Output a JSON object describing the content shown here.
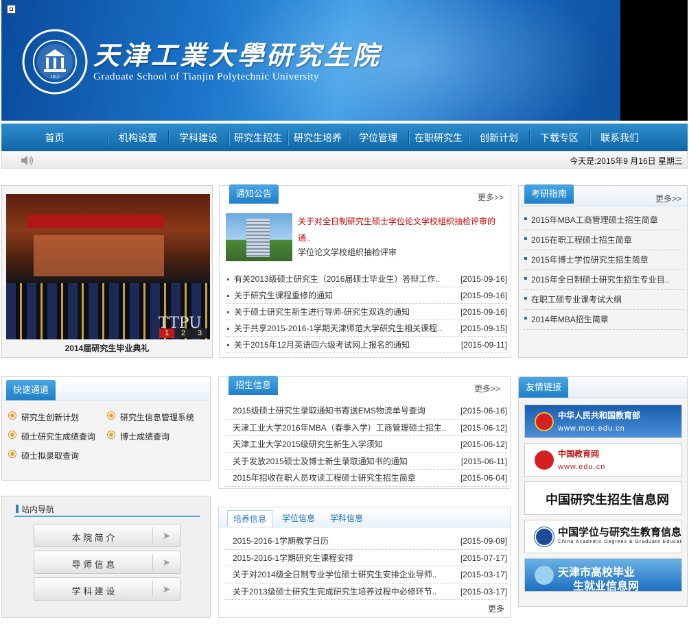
{
  "header": {
    "title_cn": "天津工業大學研究生院",
    "title_en": "Graduate School of Tianjin Polytechnic University"
  },
  "nav": [
    "首页",
    "机构设置",
    "学科建设",
    "研究生招生",
    "研究生培养",
    "学位管理",
    "在职研究生",
    "创新计划",
    "下载专区",
    "联系我们"
  ],
  "date_text": "今天是:2015年9 月16日  星期三",
  "slideshow": {
    "caption": "2014届研究生毕业典礼",
    "overlay": "TTPU",
    "pages": [
      "1",
      "2",
      "3"
    ],
    "active": "1"
  },
  "notice": {
    "title": "通知公告",
    "more": "更多>>",
    "headline": "关于对全日制研究生硕士学位论文学校组织抽检评审的通..",
    "summary": "学位论文学校组织抽检评审",
    "items": [
      {
        "t": "有关2013级硕士研究生（2016届硕士毕业生）答辩工作..",
        "d": "[2015-09-16]"
      },
      {
        "t": "关于研究生课程重修的通知",
        "d": "[2015-09-16]"
      },
      {
        "t": "关于硕士研究生新生进行导师-研究生双选的通知",
        "d": "[2015-09-16]"
      },
      {
        "t": "关于共享2015-2016-1学期天津师范大学研究生相关课程..",
        "d": "[2015-09-15]"
      },
      {
        "t": "关于2015年12月英语四六级考试网上报名的通知",
        "d": "[2015-09-11]"
      }
    ]
  },
  "guide": {
    "title": "考研指南",
    "more": "更多>>",
    "items": [
      "2015年MBA工商管理硕士招生简章",
      "2015在职工程硕士招生简章",
      "2015年博士学位研究生招生简章",
      "2015年全日制硕士研究生招生专业目..",
      "在职工硕专业课考试大纲",
      "2014年MBA招生简章"
    ]
  },
  "quick": {
    "title": "快速通道",
    "links": [
      "研究生创新计划",
      "研究生信息管理系统",
      "硕士研究生成绩查询",
      "博士成绩查询",
      "硕士拟录取查询"
    ]
  },
  "admission": {
    "title": "招生信息",
    "more": "更多>>",
    "items": [
      {
        "t": "2015级硕士研究生录取通知书寄送EMS物流单号查询",
        "d": "[2015-06-16]"
      },
      {
        "t": "天津工业大学2016年MBA（春季入学）工商管理硕士招生..",
        "d": "[2015-06-12]"
      },
      {
        "t": "天津工业大学2015级研究生新生入学须知",
        "d": "[2015-06-12]"
      },
      {
        "t": "关于发放2015硕士及博士新生录取通知书的通知",
        "d": "[2015-06-11]"
      },
      {
        "t": "2015年招收在职人员攻读工程硕士研究生招生简章",
        "d": "[2015-06-04]"
      }
    ]
  },
  "training": {
    "tabs": [
      "培养信息",
      "学位信息",
      "学科信息"
    ],
    "more": "更多",
    "items": [
      {
        "t": "2015-2016-1学期教学日历",
        "d": "[2015-09-09]"
      },
      {
        "t": "2015-2016-1学期研究生课程安排",
        "d": "[2015-07-17]"
      },
      {
        "t": "关于对2014级全日制专业学位硕士研究生安排企业导师..",
        "d": "[2015-03-17]"
      },
      {
        "t": "关于2013级硕士研究生完成研究生培养过程中必修环节..",
        "d": "[2015-03-17]"
      }
    ]
  },
  "sitenav": {
    "title": "站内导航",
    "buttons": [
      "本 院 简 介",
      "导 师 信 息",
      "学 科 建 设"
    ]
  },
  "links": {
    "title": "友情链接",
    "items": [
      {
        "cn": "中华人民共和国教育部",
        "en": "www.moe.edu.cn"
      },
      {
        "cn": "中国教育网",
        "en": "www.edu.cn"
      },
      {
        "cn": "中国研究生招生信息网",
        "en": ""
      },
      {
        "cn": "中国学位与研究生教育信息网",
        "en": "China Academic Degrees & Graduate Education Information"
      },
      {
        "cn": "天津市高校毕业",
        "en": "生就业信息网"
      }
    ]
  }
}
